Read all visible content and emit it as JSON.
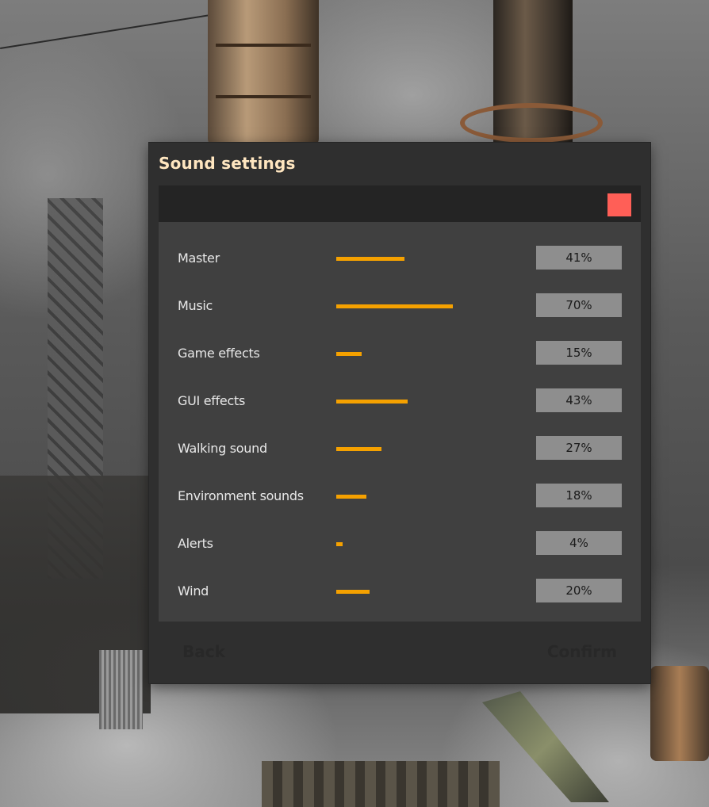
{
  "dialog": {
    "title": "Sound settings",
    "close_color": "#ff5f57",
    "accent_color": "#f5a100"
  },
  "settings": [
    {
      "label": "Master",
      "value": 41,
      "display": "41%"
    },
    {
      "label": "Music",
      "value": 70,
      "display": "70%"
    },
    {
      "label": "Game effects",
      "value": 15,
      "display": "15%"
    },
    {
      "label": "GUI effects",
      "value": 43,
      "display": "43%"
    },
    {
      "label": "Walking sound",
      "value": 27,
      "display": "27%"
    },
    {
      "label": "Environment sounds",
      "value": 18,
      "display": "18%"
    },
    {
      "label": "Alerts",
      "value": 4,
      "display": "4%"
    },
    {
      "label": "Wind",
      "value": 20,
      "display": "20%"
    }
  ],
  "footer": {
    "back_label": "Back",
    "confirm_label": "Confirm"
  }
}
